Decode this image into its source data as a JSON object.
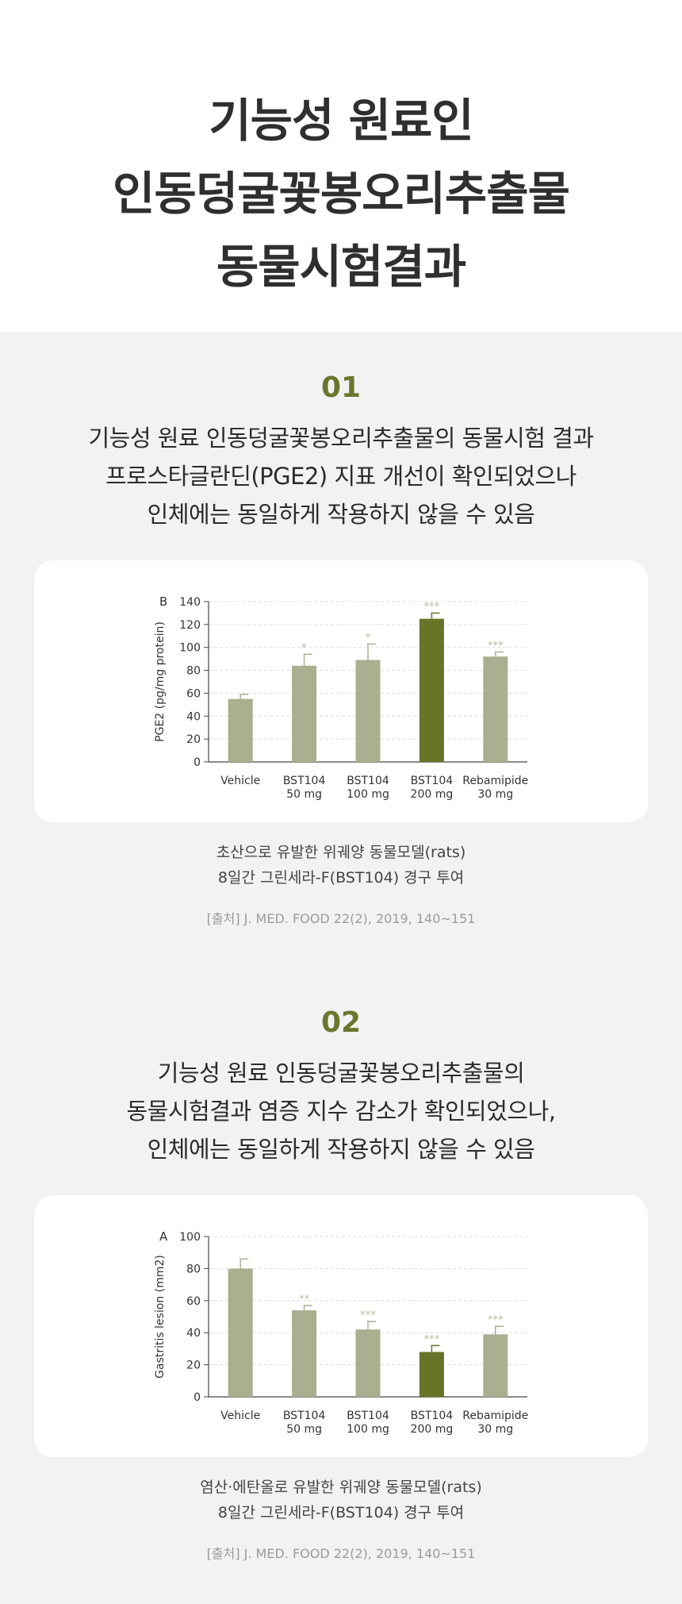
{
  "page": {
    "title_lines": [
      "기능성 원료인",
      "인동덩굴꽃봉오리추출물",
      "동물시험결과"
    ]
  },
  "sections": [
    {
      "number": "01",
      "headline_lines": [
        "기능성 원료 인동덩굴꽃봉오리추출물의 동물시험 결과",
        "프로스타글란딘(PGE2) 지표 개선이 확인되었으나",
        "인체에는 동일하게 작용하지 않을 수 있음"
      ],
      "caption_lines": [
        "초산으로 유발한 위궤양 동물모델(rats)",
        "8일간 그린세라-F(BST104) 경구 투여"
      ],
      "source": "[출처] J. MED. FOOD 22(2), 2019, 140~151"
    },
    {
      "number": "02",
      "headline_lines": [
        "기능성 원료 인동덩굴꽃봉오리추출물의",
        "동물시험결과 염증 지수 감소가 확인되었으나,",
        "인체에는 동일하게 작용하지 않을 수 있음"
      ],
      "caption_lines": [
        "염산·에탄올로 유발한 위궤양 동물모델(rats)",
        "8일간 그린세라-F(BST104) 경구 투여"
      ],
      "source": "[출처] J. MED. FOOD 22(2), 2019, 140~151"
    }
  ],
  "chart_data": [
    {
      "type": "bar",
      "panel_label": "B",
      "ylabel": "PGE2 (pg/mg protein)",
      "ylim": [
        0,
        140
      ],
      "yticks": [
        0,
        20,
        40,
        60,
        80,
        100,
        120,
        140
      ],
      "grid": true,
      "categories": [
        [
          "Vehicle",
          ""
        ],
        [
          "BST104",
          "50 mg"
        ],
        [
          "BST104",
          "100 mg"
        ],
        [
          "BST104",
          "200 mg"
        ],
        [
          "Rebamipide",
          "30 mg"
        ]
      ],
      "values": [
        55,
        84,
        89,
        125,
        92
      ],
      "errors": [
        4,
        10,
        14,
        5,
        4
      ],
      "significance": [
        "",
        "*",
        "*",
        "***",
        "***"
      ],
      "highlight_index": 3,
      "colors": {
        "bar": "#a9b08f",
        "highlight": "#667528",
        "star": "#b8bc9b",
        "star_highlight": "#b8bc9b"
      }
    },
    {
      "type": "bar",
      "panel_label": "A",
      "ylabel": "Gastritis lesion (mm2)",
      "ylim": [
        0,
        100
      ],
      "yticks": [
        0,
        20,
        40,
        60,
        80,
        100
      ],
      "grid": true,
      "categories": [
        [
          "Vehicle",
          ""
        ],
        [
          "BST104",
          "50 mg"
        ],
        [
          "BST104",
          "100 mg"
        ],
        [
          "BST104",
          "200 mg"
        ],
        [
          "Rebamipide",
          "30 mg"
        ]
      ],
      "values": [
        80,
        54,
        42,
        28,
        39
      ],
      "errors": [
        6,
        3,
        5,
        4,
        5
      ],
      "significance": [
        "",
        "**",
        "***",
        "***",
        "***"
      ],
      "highlight_index": 3,
      "colors": {
        "bar": "#a9b08f",
        "highlight": "#667528",
        "star": "#b8bc9b",
        "star_highlight": "#b8bc9b"
      }
    }
  ]
}
